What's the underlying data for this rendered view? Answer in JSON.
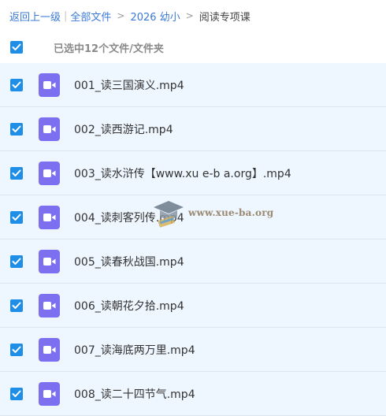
{
  "breadcrumb": {
    "back": "返回上一级",
    "all_files": "全部文件",
    "folder1": "2026 幼小",
    "current": "阅读专项课"
  },
  "selection": {
    "count_text": "已选中12个文件/文件夹"
  },
  "files": [
    {
      "name": "001_读三国演义.mp4",
      "checked": true
    },
    {
      "name": "002_读西游记.mp4",
      "checked": true
    },
    {
      "name": "003_读水浒传【www.xu e-b a.org】.mp4",
      "checked": true
    },
    {
      "name": "004_读刺客列传.mp4",
      "checked": true
    },
    {
      "name": "005_读春秋战国.mp4",
      "checked": true
    },
    {
      "name": "006_读朝花夕拾.mp4",
      "checked": true
    },
    {
      "name": "007_读海底两万里.mp4",
      "checked": true
    },
    {
      "name": "008_读二十四节气.mp4",
      "checked": true
    }
  ],
  "watermark": {
    "text": "www.xue-ba.org"
  },
  "colors": {
    "link": "#3a7ad6",
    "checkbox": "#1f8ee6",
    "video_icon": "#7c6ff0",
    "row_bg": "#eef6ff"
  },
  "icons": {
    "checkbox": "checkmark",
    "file": "video-camera",
    "watermark": "graduation-cap"
  }
}
